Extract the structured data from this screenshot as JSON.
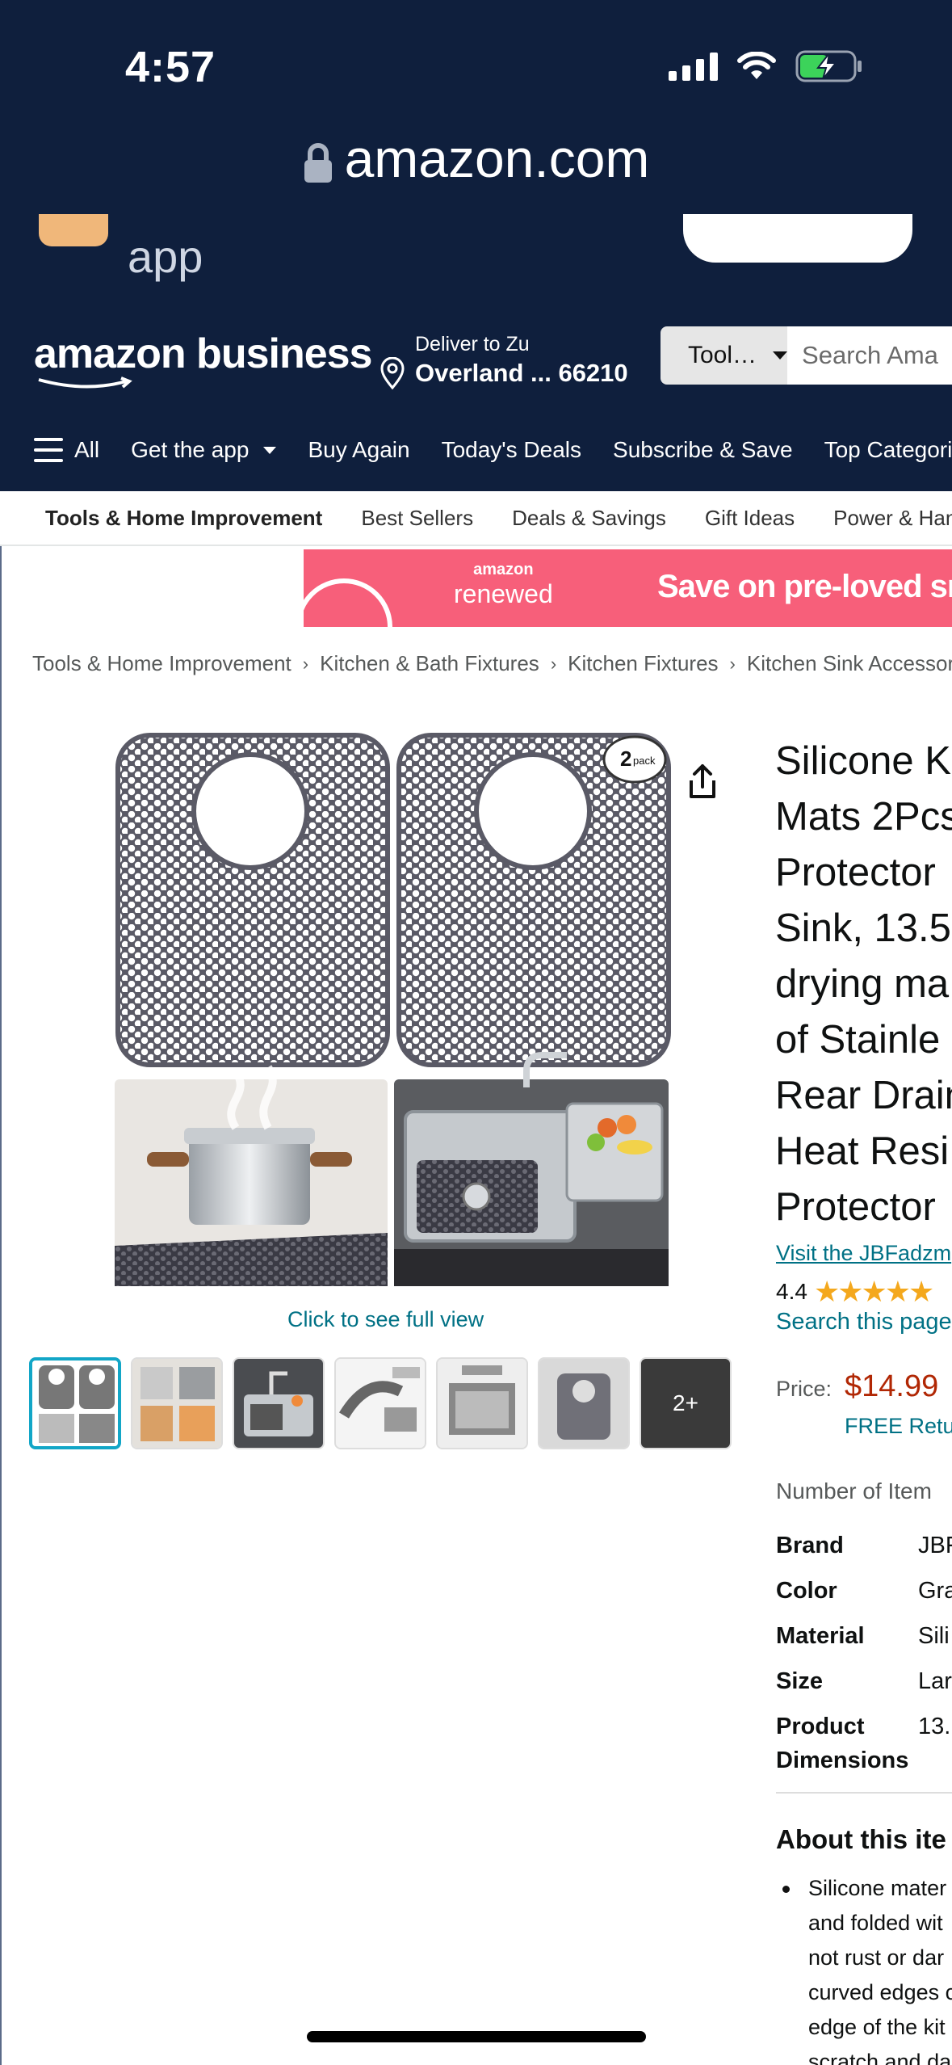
{
  "status_bar": {
    "time": "4:57"
  },
  "browser": {
    "url": "amazon.com"
  },
  "app_banner": {
    "text": "app"
  },
  "header": {
    "logo": "amazon business",
    "deliver_line1": "Deliver to Zu",
    "deliver_line2": "Overland ... 66210",
    "search_scope": "Tool…",
    "search_placeholder": "Search Ama"
  },
  "nav": {
    "all": "All",
    "get_app": "Get the app",
    "buy_again": "Buy Again",
    "todays_deals": "Today's Deals",
    "subscribe": "Subscribe & Save",
    "top_categories": "Top Categori"
  },
  "subnav": [
    "Tools & Home Improvement",
    "Best Sellers",
    "Deals & Savings",
    "Gift Ideas",
    "Power & Hand"
  ],
  "banner": {
    "brand_top": "amazon",
    "brand_bottom": "renewed",
    "promo": "Save on pre-loved sm"
  },
  "breadcrumb": [
    "Tools & Home Improvement",
    "Kitchen & Bath Fixtures",
    "Kitchen Fixtures",
    "Kitchen Sink Accessori"
  ],
  "gallery": {
    "click_full": "Click to see full view",
    "more_count": "2+",
    "pack_badge": "2 pack"
  },
  "product": {
    "title_lines": [
      "Silicone K",
      "Mats 2Pcs",
      "Protector",
      "Sink, 13.5",
      "drying ma",
      "of Stainle",
      "Rear Drain",
      "Heat Resi",
      "Protector"
    ],
    "store_link": "Visit the JBFadzm",
    "rating": "4.4",
    "search_page": "Search this page",
    "price_label": "Price:",
    "price": "$14.99",
    "returns": "FREE Retur",
    "number_of_items": "Number of Item"
  },
  "specs": [
    {
      "k": "Brand",
      "v": "JBF"
    },
    {
      "k": "Color",
      "v": "Gra"
    },
    {
      "k": "Material",
      "v": "Sili"
    },
    {
      "k": "Size",
      "v": "Lar"
    },
    {
      "k": "Product Dimensions",
      "v": "13."
    }
  ],
  "about": {
    "heading": "About this ite",
    "bullet_lines": [
      "Silicone mater",
      "and folded wit",
      "not rust or dar",
      "curved edges c",
      "edge of the kit",
      "scratch and da"
    ]
  },
  "colors": {
    "navy": "#0f1f3d",
    "link": "#007185",
    "price": "#b12704",
    "star": "#f4a81d",
    "banner": "#f75f7a"
  }
}
